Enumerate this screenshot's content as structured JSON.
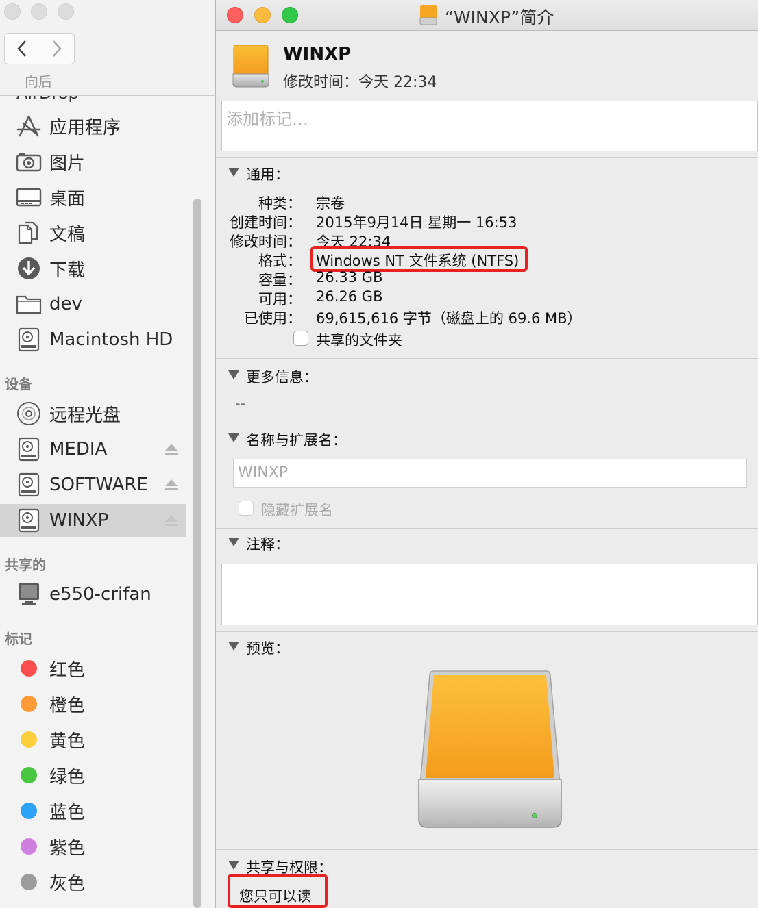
{
  "finder": {
    "nav_label": "向后",
    "partial_item": "AirDrop",
    "favorites": [
      {
        "label": "应用程序",
        "icon": "applications-icon"
      },
      {
        "label": "图片",
        "icon": "camera-icon"
      },
      {
        "label": "桌面",
        "icon": "desktop-icon"
      },
      {
        "label": "文稿",
        "icon": "documents-icon"
      },
      {
        "label": "下载",
        "icon": "download-icon"
      },
      {
        "label": "dev",
        "icon": "folder-icon"
      },
      {
        "label": "Macintosh HD",
        "icon": "hard-drive-icon"
      }
    ],
    "devices_heading": "设备",
    "devices": [
      {
        "label": "远程光盘",
        "icon": "optical-disc-icon"
      },
      {
        "label": "MEDIA",
        "icon": "hard-drive-icon",
        "eject": true
      },
      {
        "label": "SOFTWARE",
        "icon": "hard-drive-icon",
        "eject": true
      },
      {
        "label": "WINXP",
        "icon": "hard-drive-icon",
        "eject": true,
        "selected": true
      }
    ],
    "shared_heading": "共享的",
    "shared": [
      {
        "label": "e550-crifan",
        "icon": "computer-icon"
      }
    ],
    "tags_heading": "标记",
    "tags": [
      {
        "label": "红色",
        "color": "#fc4d4e"
      },
      {
        "label": "橙色",
        "color": "#fd9a35"
      },
      {
        "label": "黄色",
        "color": "#fdce3b"
      },
      {
        "label": "绿色",
        "color": "#49c63f"
      },
      {
        "label": "蓝色",
        "color": "#2ea2f5"
      },
      {
        "label": "紫色",
        "color": "#cf7fe0"
      },
      {
        "label": "灰色",
        "color": "#9b9b9b"
      }
    ]
  },
  "info": {
    "window_title": "“WINXP”简介",
    "header": {
      "name": "WINXP",
      "modified_label": "修改时间：",
      "modified_value": "今天 22:34"
    },
    "tags_placeholder": "添加标记…",
    "general": {
      "title": "通用：",
      "rows": [
        {
          "label": "种类：",
          "value": "宗卷"
        },
        {
          "label": "创建时间：",
          "value": "2015年9月14日 星期一 16:53"
        },
        {
          "label": "修改时间：",
          "value": "今天 22:34"
        },
        {
          "label": "格式：",
          "value": "Windows NT 文件系统 (NTFS)"
        },
        {
          "label": "容量：",
          "value": "26.33 GB"
        },
        {
          "label": "可用：",
          "value": "26.26 GB"
        },
        {
          "label": "已使用：",
          "value": "69,615,616 字节（磁盘上的 69.6 MB）"
        }
      ],
      "shared_folder_label": "共享的文件夹"
    },
    "more_info": {
      "title": "更多信息：",
      "value": "--"
    },
    "name_ext": {
      "title": "名称与扩展名：",
      "name_value": "WINXP",
      "hide_ext_label": "隐藏扩展名"
    },
    "comments": {
      "title": "注释："
    },
    "preview": {
      "title": "预览："
    },
    "sharing": {
      "title": "共享与权限：",
      "status": "您只可以读"
    },
    "colors": {
      "highlight": "#e62222",
      "close": "#fc605c",
      "minimize": "#fdbc40",
      "zoom": "#34c84a"
    }
  }
}
